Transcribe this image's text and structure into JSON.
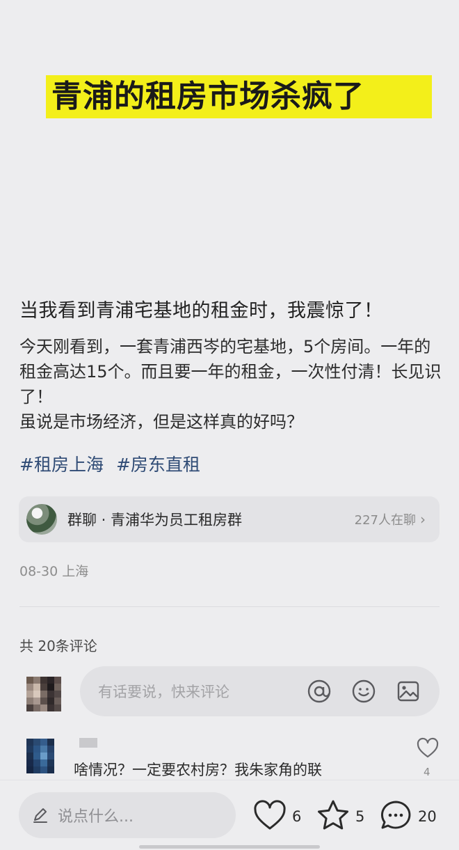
{
  "hero": {
    "title": "青浦的租房市场杀疯了",
    "highlight_color": "#f3ef1a"
  },
  "post": {
    "heading": "当我看到青浦宅基地的租金时，我震惊了！",
    "body_lines": [
      "今天刚看到，一套青浦西岑的宅基地，5个房间。一年的租金高达15个。而且要一年的租金，一次性付清！长见识了！",
      "虽说是市场经济，但是这样真的好吗？"
    ],
    "tags": [
      "#租房上海",
      "#房东直租"
    ],
    "tag_color": "#2f4b75"
  },
  "group_chat": {
    "name": "群聊 · 青浦华为员工租房群",
    "online": "227人在聊",
    "chevron": "›"
  },
  "meta": {
    "date_location": "08-30 上海"
  },
  "comments": {
    "count_label": "共 20条评论",
    "input_placeholder": "有话要说，快来评论",
    "input_icons": [
      "at-icon",
      "emoji-icon",
      "image-icon"
    ],
    "items": [
      {
        "text": "啥情况？一定要农村房？我朱家角的联",
        "likes": "4"
      }
    ]
  },
  "bottom_bar": {
    "placeholder": "说点什么...",
    "likes": "6",
    "favorites": "5",
    "comments": "20"
  }
}
